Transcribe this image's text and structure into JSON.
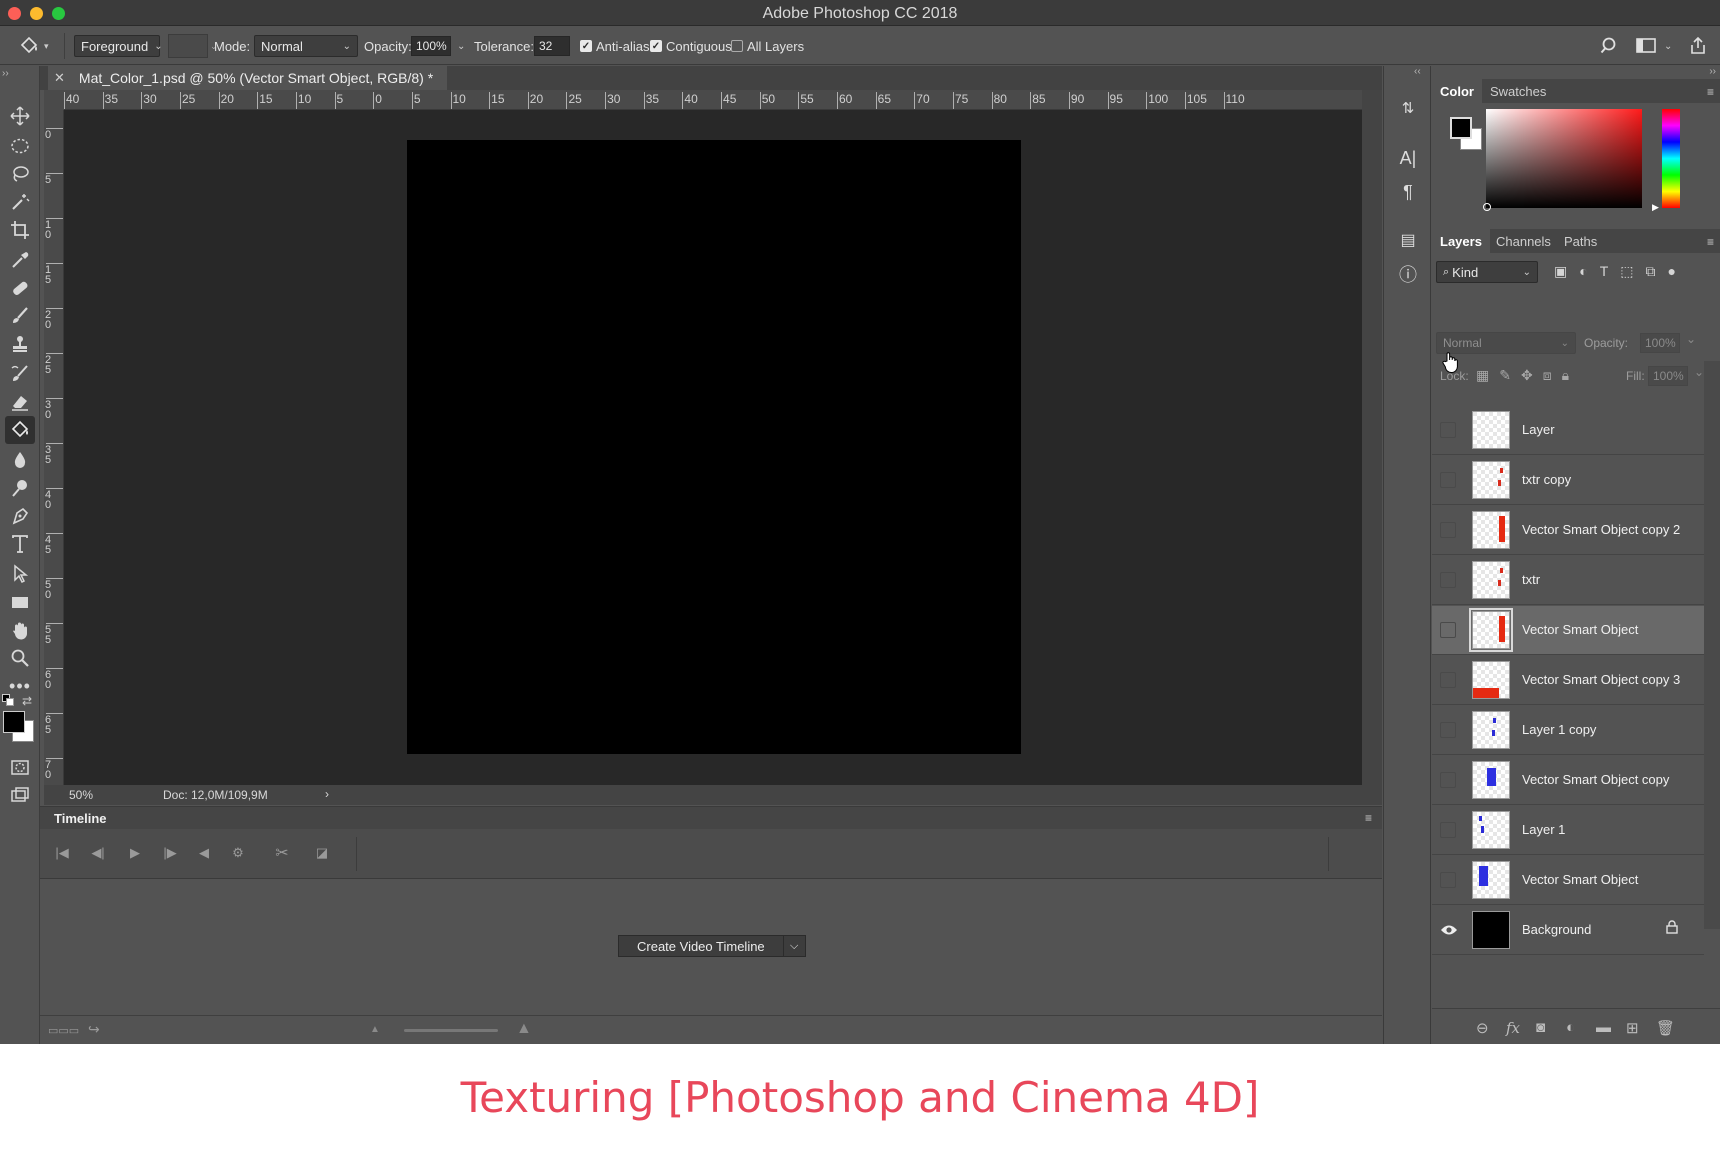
{
  "window": {
    "title": "Adobe Photoshop CC 2018"
  },
  "options_bar": {
    "fill_source": "Foreground",
    "mode_label": "Mode:",
    "mode_value": "Normal",
    "opacity_label": "Opacity:",
    "opacity_value": "100%",
    "tolerance_label": "Tolerance:",
    "tolerance_value": "32",
    "anti_alias_label": "Anti-alias",
    "anti_alias_checked": true,
    "contiguous_label": "Contiguous",
    "contiguous_checked": true,
    "all_layers_label": "All Layers",
    "all_layers_checked": false
  },
  "document": {
    "tab_title": "Mat_Color_1.psd @ 50% (Vector Smart Object, RGB/8) *",
    "zoom": "50%",
    "doc_size": "Doc: 12,0M/109,9M",
    "ruler_h": [
      "40",
      "35",
      "30",
      "25",
      "20",
      "15",
      "10",
      "5",
      "0",
      "5",
      "10",
      "15",
      "20",
      "25",
      "30",
      "35",
      "40",
      "45",
      "50",
      "55",
      "60",
      "65",
      "70",
      "75",
      "80",
      "85",
      "90",
      "95",
      "100",
      "105",
      "110"
    ],
    "ruler_v": [
      "0",
      "5",
      "10",
      "15",
      "20",
      "25",
      "30",
      "35",
      "40",
      "45",
      "50",
      "55",
      "60",
      "65",
      "70"
    ]
  },
  "timeline": {
    "title": "Timeline",
    "create_button": "Create Video Timeline"
  },
  "color_panel": {
    "tabs": [
      "Color",
      "Swatches"
    ],
    "active_tab": "Color",
    "foreground": "#000000",
    "background": "#ffffff"
  },
  "layers_panel": {
    "tabs": [
      "Layers",
      "Channels",
      "Paths"
    ],
    "active_tab": "Layers",
    "filter_kind": "Kind",
    "blend_mode": "Normal",
    "opacity_label": "Opacity:",
    "opacity_value": "100%",
    "lock_label": "Lock:",
    "fill_label": "Fill:",
    "fill_value": "100%",
    "layers": [
      {
        "name": "Layer",
        "visible": false,
        "selected": false,
        "thumb": "empty"
      },
      {
        "name": "txtr copy",
        "visible": false,
        "selected": false,
        "thumb": "red-dots"
      },
      {
        "name": "Vector Smart Object copy 2",
        "visible": false,
        "selected": false,
        "thumb": "red-bar-right"
      },
      {
        "name": "txtr",
        "visible": false,
        "selected": false,
        "thumb": "red-dots"
      },
      {
        "name": "Vector Smart Object",
        "visible": false,
        "selected": true,
        "thumb": "red-bar-right"
      },
      {
        "name": "Vector Smart Object copy 3",
        "visible": false,
        "selected": false,
        "thumb": "red-bar-bottom"
      },
      {
        "name": "Layer 1 copy",
        "visible": false,
        "selected": false,
        "thumb": "blue-dots"
      },
      {
        "name": "Vector Smart Object copy",
        "visible": false,
        "selected": false,
        "thumb": "blue-bar"
      },
      {
        "name": "Layer 1",
        "visible": false,
        "selected": false,
        "thumb": "blue-dots-left"
      },
      {
        "name": "Vector Smart Object",
        "visible": false,
        "selected": false,
        "thumb": "blue-bar-left"
      },
      {
        "name": "Background",
        "visible": true,
        "selected": false,
        "thumb": "black",
        "locked": true
      }
    ]
  },
  "caption": "Texturing [Photoshop and Cinema 4D]"
}
